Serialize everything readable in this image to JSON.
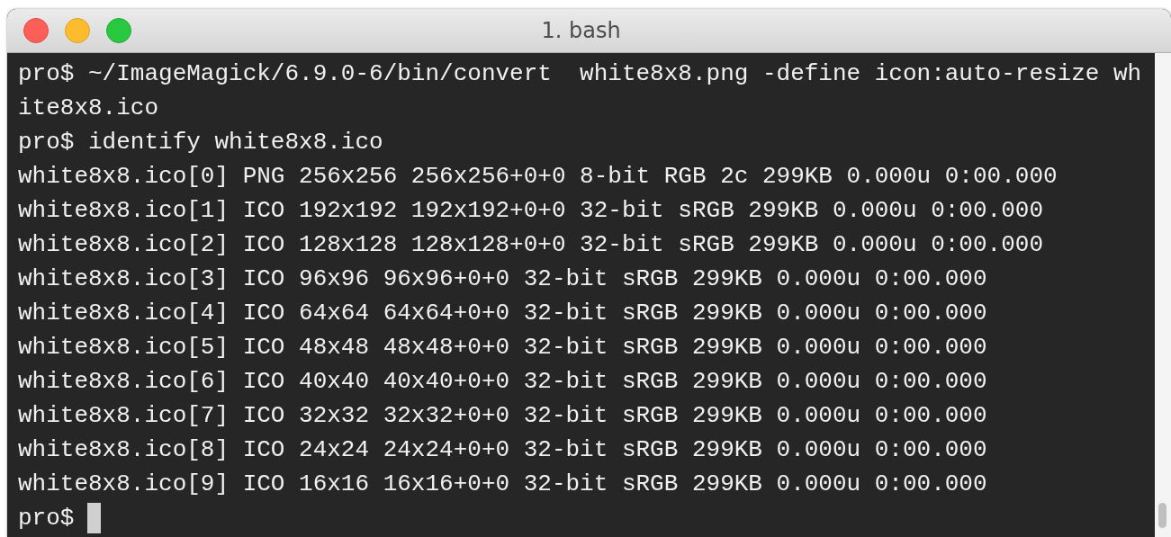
{
  "window": {
    "title": "1. bash"
  },
  "terminal": {
    "lines": [
      "pro$ ~/ImageMagick/6.9.0-6/bin/convert  white8x8.png -define icon:auto-resize wh",
      "ite8x8.ico",
      "pro$ identify white8x8.ico",
      "white8x8.ico[0] PNG 256x256 256x256+0+0 8-bit RGB 2c 299KB 0.000u 0:00.000",
      "white8x8.ico[1] ICO 192x192 192x192+0+0 32-bit sRGB 299KB 0.000u 0:00.000",
      "white8x8.ico[2] ICO 128x128 128x128+0+0 32-bit sRGB 299KB 0.000u 0:00.000",
      "white8x8.ico[3] ICO 96x96 96x96+0+0 32-bit sRGB 299KB 0.000u 0:00.000",
      "white8x8.ico[4] ICO 64x64 64x64+0+0 32-bit sRGB 299KB 0.000u 0:00.000",
      "white8x8.ico[5] ICO 48x48 48x48+0+0 32-bit sRGB 299KB 0.000u 0:00.000",
      "white8x8.ico[6] ICO 40x40 40x40+0+0 32-bit sRGB 299KB 0.000u 0:00.000",
      "white8x8.ico[7] ICO 32x32 32x32+0+0 32-bit sRGB 299KB 0.000u 0:00.000",
      "white8x8.ico[8] ICO 24x24 24x24+0+0 32-bit sRGB 299KB 0.000u 0:00.000",
      "white8x8.ico[9] ICO 16x16 16x16+0+0 32-bit sRGB 299KB 0.000u 0:00.000"
    ],
    "prompt": "pro$"
  }
}
